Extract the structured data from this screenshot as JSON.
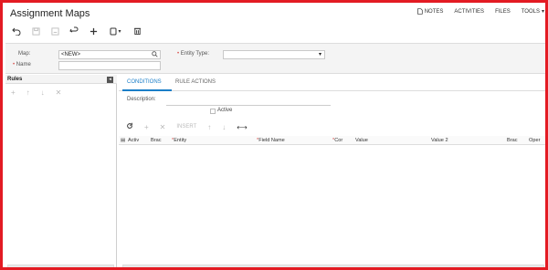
{
  "header": {
    "title": "Assignment Maps",
    "links": [
      "NOTES",
      "ACTIVITIES",
      "FILES",
      "TOOLS"
    ]
  },
  "toolbar": {
    "buttons": [
      "undo-icon",
      "save-icon",
      "save-close-icon",
      "refresh-icon",
      "add-icon",
      "copy-paste-icon",
      "delete-icon"
    ]
  },
  "form": {
    "map_label": "Map:",
    "map_value": "<NEW>",
    "name_label": "Name",
    "entity_type_label": "Entity Type:",
    "entity_type_value": ""
  },
  "rules": {
    "title": "Rules",
    "tool_icons": [
      "add-icon",
      "move-up-icon",
      "move-down-icon",
      "delete-icon"
    ]
  },
  "tabs": [
    {
      "label": "CONDITIONS",
      "active": true
    },
    {
      "label": "RULE ACTIONS",
      "active": false
    }
  ],
  "conditions": {
    "description_label": "Description:",
    "active_label": "Active",
    "active_checked": false,
    "grid_toolbar": {
      "insert_label": "INSERT"
    },
    "columns": [
      "Activ",
      "Brac",
      "Entity",
      "Field Name",
      "Cor",
      "Value",
      "Value 2",
      "Brac",
      "Oper"
    ]
  },
  "colors": {
    "accent": "#1a7ec8",
    "border": "#e31b23"
  }
}
